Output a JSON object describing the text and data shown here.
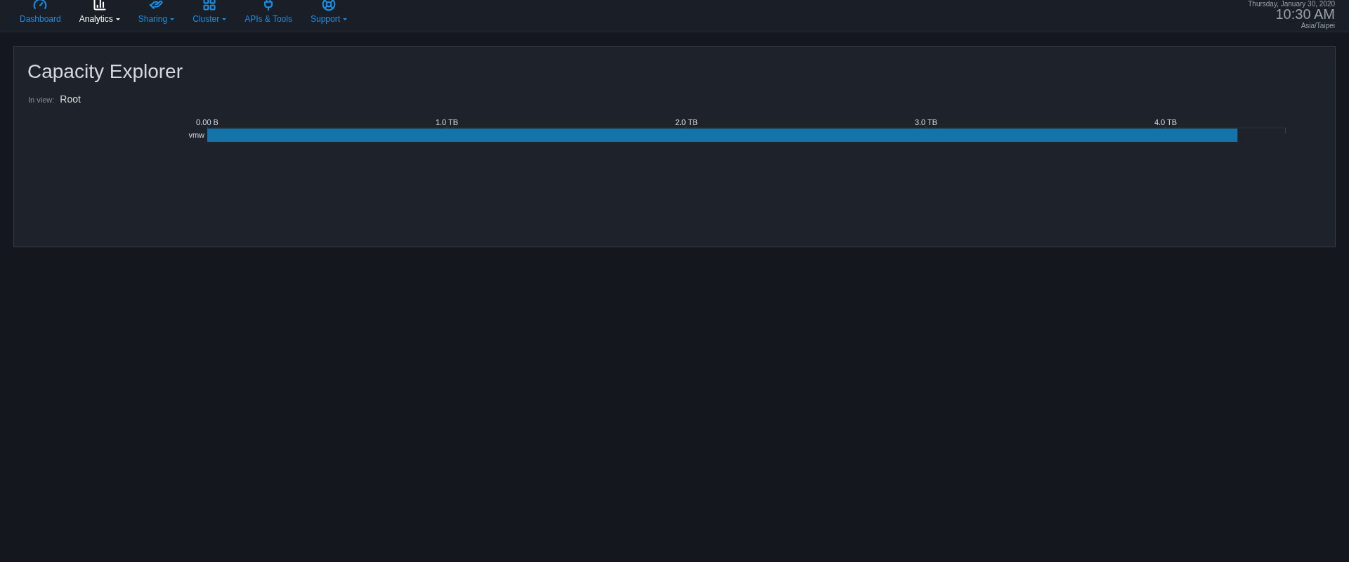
{
  "nav": {
    "items": [
      {
        "label": "Dashboard",
        "dropdown": false,
        "selected": false
      },
      {
        "label": "Analytics",
        "dropdown": true,
        "selected": true
      },
      {
        "label": "Sharing",
        "dropdown": true,
        "selected": false
      },
      {
        "label": "Cluster",
        "dropdown": true,
        "selected": false
      },
      {
        "label": "APIs & Tools",
        "dropdown": false,
        "selected": false
      },
      {
        "label": "Support",
        "dropdown": true,
        "selected": false
      }
    ]
  },
  "clock": {
    "date": "Thursday, January 30, 2020",
    "time": "10:30 AM",
    "timezone": "Asia/Taipei"
  },
  "panel": {
    "title": "Capacity Explorer",
    "in_view_label": "In view:",
    "in_view_value": "Root",
    "chart_data": {
      "type": "bar",
      "orientation": "horizontal",
      "categories": [
        "vmw"
      ],
      "series": [
        {
          "color": "#1474aa",
          "values": [
            4.3
          ]
        }
      ],
      "xlim": [
        0,
        4.5
      ],
      "xticks": [
        {
          "value": 0,
          "label": "0.00 B"
        },
        {
          "value": 1,
          "label": "1.0 TB"
        },
        {
          "value": 2,
          "label": "2.0 TB"
        },
        {
          "value": 3,
          "label": "3.0 TB"
        },
        {
          "value": 4,
          "label": "4.0 TB"
        }
      ]
    }
  }
}
